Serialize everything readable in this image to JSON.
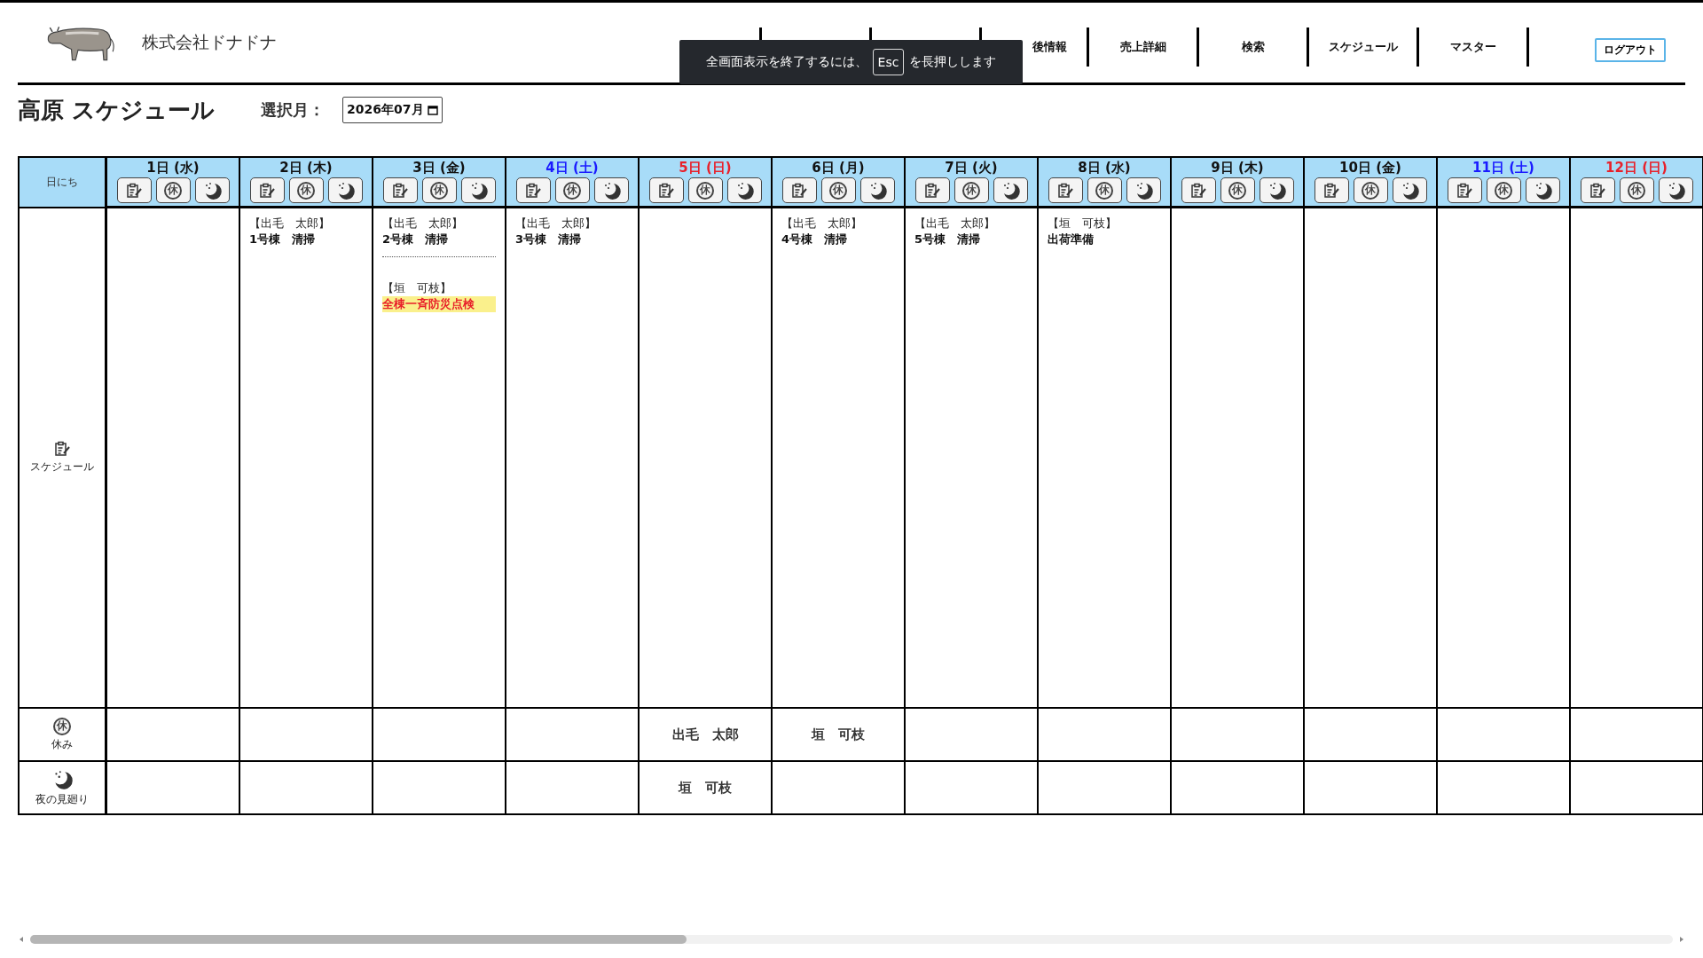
{
  "header": {
    "company": "株式会社ドナドナ",
    "nav": [
      "後情報",
      "売上詳細",
      "検索",
      "スケジュール",
      "マスター"
    ],
    "logout": "ログアウト"
  },
  "toast": {
    "before": "全画面表示を終了するには、",
    "key": "Esc",
    "after": "を長押しします"
  },
  "page": {
    "title": "高原 スケジュール",
    "month_label": "選択月：",
    "month_value": "2026年07月"
  },
  "table": {
    "corner": "日にち",
    "rows": [
      {
        "kind": "schedule",
        "label": "スケジュール"
      },
      {
        "kind": "holiday",
        "label": "休み",
        "glyph": "休"
      },
      {
        "kind": "night",
        "label": "夜の見廻り"
      }
    ],
    "days": [
      {
        "label": "1日 (水)",
        "color": "#111111",
        "holiday_glyph": "休"
      },
      {
        "label": "2日 (木)",
        "color": "#111111",
        "holiday_glyph": "休",
        "schedule": [
          {
            "person": "【出毛　太郎】",
            "task": "1号棟　清掃",
            "highlight": false
          }
        ]
      },
      {
        "label": "3日 (金)",
        "color": "#111111",
        "holiday_glyph": "休",
        "schedule": [
          {
            "person": "【出毛　太郎】",
            "task": "2号棟　清掃",
            "highlight": false
          },
          {
            "person": "【垣　可枝】",
            "task": "全棟一斉防災点検",
            "highlight": true
          }
        ]
      },
      {
        "label": "4日 (土)",
        "color": "#1a1aff",
        "holiday_glyph": "休",
        "schedule": [
          {
            "person": "【出毛　太郎】",
            "task": "3号棟　清掃",
            "highlight": false
          }
        ]
      },
      {
        "label": "5日 (日)",
        "color": "#e8202a",
        "holiday_glyph": "休",
        "off": "出毛　太郎",
        "night": "垣　可枝"
      },
      {
        "label": "6日 (月)",
        "color": "#111111",
        "holiday_glyph": "休",
        "schedule": [
          {
            "person": "【出毛　太郎】",
            "task": "4号棟　清掃",
            "highlight": false
          }
        ],
        "off": "垣　可枝"
      },
      {
        "label": "7日 (火)",
        "color": "#111111",
        "holiday_glyph": "休",
        "schedule": [
          {
            "person": "【出毛　太郎】",
            "task": "5号棟　清掃",
            "highlight": false
          }
        ]
      },
      {
        "label": "8日 (水)",
        "color": "#111111",
        "holiday_glyph": "休",
        "schedule": [
          {
            "person": "【垣　可枝】",
            "task": "出荷準備",
            "highlight": false
          }
        ]
      },
      {
        "label": "9日 (木)",
        "color": "#111111",
        "holiday_glyph": "休"
      },
      {
        "label": "10日 (金)",
        "color": "#111111",
        "holiday_glyph": "休"
      },
      {
        "label": "11日 (土)",
        "color": "#1a1aff",
        "holiday_glyph": "休"
      },
      {
        "label": "12日 (日)",
        "color": "#e8202a",
        "holiday_glyph": "休"
      }
    ]
  }
}
